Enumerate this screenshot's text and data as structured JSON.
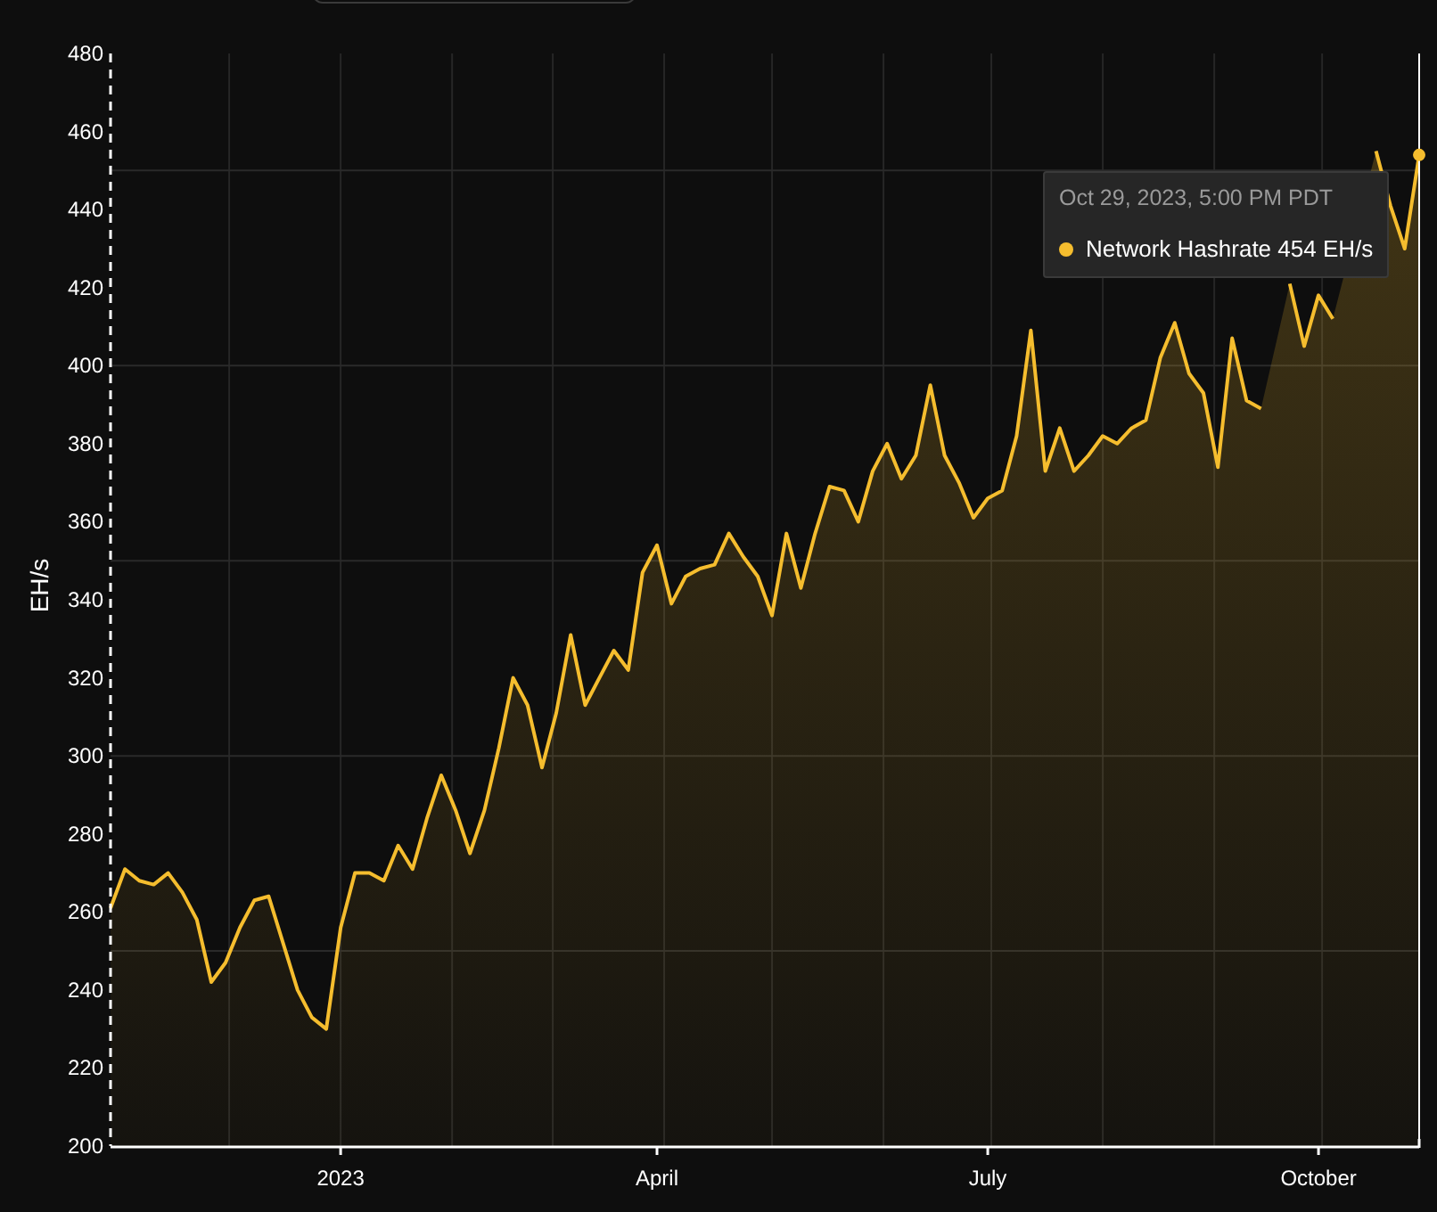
{
  "chart": {
    "chart_data": {
      "type": "area",
      "ylabel": "EH/s",
      "ylim": [
        200,
        480
      ],
      "grid": true,
      "yticks": [
        200,
        220,
        240,
        260,
        280,
        300,
        320,
        340,
        360,
        380,
        400,
        420,
        440,
        460,
        480
      ],
      "categories": [
        null,
        null,
        null,
        null,
        null,
        null,
        null,
        null,
        null,
        null,
        null,
        null,
        null,
        null,
        null,
        null,
        "2023",
        null,
        null,
        null,
        null,
        null,
        null,
        null,
        null,
        null,
        null,
        null,
        null,
        null,
        null,
        null,
        null,
        null,
        null,
        null,
        null,
        null,
        "April",
        null,
        null,
        null,
        null,
        null,
        null,
        null,
        null,
        null,
        null,
        null,
        null,
        null,
        null,
        null,
        null,
        null,
        null,
        null,
        null,
        null,
        null,
        "July",
        null,
        null,
        null,
        null,
        null,
        null,
        null,
        null,
        null,
        null,
        null,
        null,
        null,
        null,
        null,
        null,
        null,
        null,
        null,
        null,
        null,
        null,
        "October",
        null,
        null,
        null,
        null,
        null,
        null,
        null
      ],
      "series": [
        {
          "name": "Network Hashrate",
          "color": "#f5bd2e",
          "values": [
            261,
            271,
            268,
            267,
            270,
            265,
            258,
            242,
            247,
            256,
            263,
            264,
            252,
            240,
            233,
            230,
            256,
            270,
            270,
            268,
            277,
            271,
            284,
            295,
            286,
            275,
            286,
            302,
            320,
            313,
            297,
            311,
            331,
            313,
            320,
            327,
            322,
            347,
            354,
            339,
            346,
            348,
            349,
            357,
            351,
            346,
            336,
            357,
            343,
            357,
            369,
            368,
            360,
            373,
            380,
            371,
            377,
            395,
            377,
            370,
            361,
            366,
            368,
            382,
            409,
            373,
            384,
            373,
            377,
            382,
            380,
            384,
            386,
            402,
            411,
            398,
            393,
            374,
            407,
            391,
            389,
            null,
            421,
            405,
            418,
            412,
            null,
            null,
            455,
            441,
            430,
            454
          ]
        }
      ]
    },
    "tooltip": {
      "title": "Oct 29, 2023, 5:00 PM PDT",
      "value": "454 EH/s"
    }
  }
}
